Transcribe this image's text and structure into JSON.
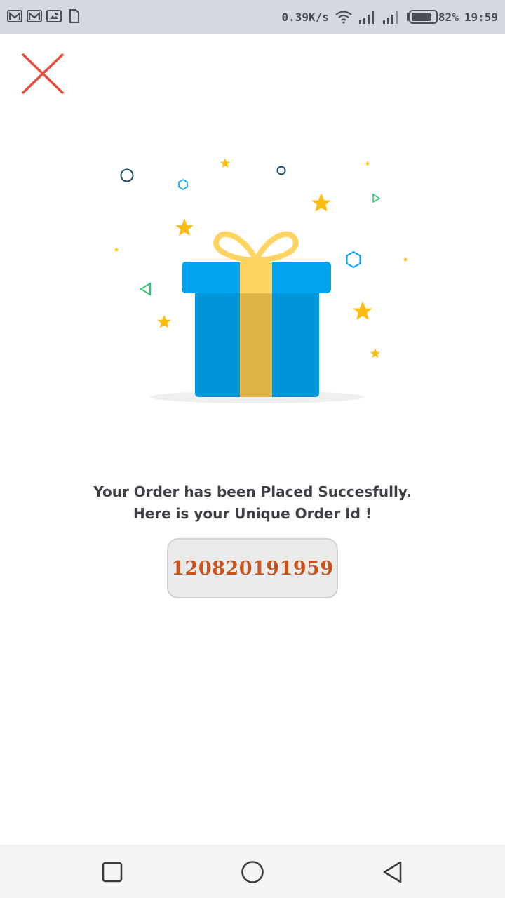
{
  "status_bar": {
    "network_speed": "0.39K/s",
    "battery_percent": "82%",
    "time": "19:59",
    "battery_level": 0.82,
    "left_icons": [
      "gmail-icon",
      "gmail-icon",
      "screenshot-icon",
      "sd-card-icon"
    ],
    "right_icons": [
      "wifi-icon",
      "signal-icon",
      "signal-icon",
      "battery-icon"
    ]
  },
  "header": {
    "close_icon": "close-icon",
    "close_color": "#e74c3c"
  },
  "illustration": {
    "name": "gift-box-icon",
    "colors": {
      "box_blue": "#0094d9",
      "lid_blue": "#03a4ef",
      "ribbon_yellow": "#ffd462",
      "ribbon_dark": "#e0b545",
      "star_yellow": "#fdbd10"
    }
  },
  "message": {
    "line1": "Your Order has been Placed Succesfully.",
    "line2": "Here is your Unique Order Id !"
  },
  "order": {
    "id": "120820191959",
    "id_color": "#c8531d"
  },
  "nav_bar": {
    "icons": [
      "recents-icon",
      "home-icon",
      "back-icon"
    ]
  }
}
